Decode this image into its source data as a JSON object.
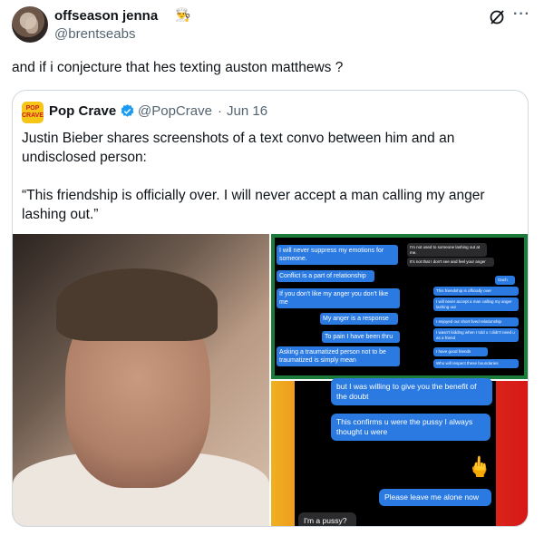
{
  "author": {
    "name": "offseason jenna",
    "name_emoji": "👨‍🍳",
    "handle": "@brentseabs"
  },
  "actions": {
    "more": "···"
  },
  "tweet": {
    "text": "and if i conjecture that hes texting auston matthews ?"
  },
  "quote": {
    "avatar_text": "POP CRAVE",
    "name": "Pop Crave",
    "handle": "@PopCrave",
    "separator": "·",
    "date": "Jun 16",
    "paragraph1": "Justin Bieber shares screenshots of a text convo between him and an undisclosed person:",
    "paragraph2": "“This friendship is officially over. I will never accept a man calling my anger lashing out.”"
  },
  "screenshot1": {
    "left": [
      "I will never suppress my emotions for someone.",
      "Conflict is a part of relationship",
      "If you don't like my anger you don't like me",
      "My anger is a response",
      "To pain I have been thru",
      "Asking a traumatized person not to be traumatized is simply mean"
    ],
    "right_gray": [
      "I'm not used to someone lashing out at me.",
      "It's not that I don't see and feel your anger"
    ],
    "right_blue": [
      "Ouch",
      "This friendship is officially over",
      "I will never accept a man calling my anger lashing out",
      "I enjoyed our short lived relationship",
      "I wasn't kidding when I told u I didn't need u as a friend",
      "I have good friends",
      "Who will respect these boundaries"
    ]
  },
  "screenshot2": {
    "msg1": "but I was willing to give you the benefit of the doubt",
    "msg2": "This confirms u were the pussy I always thought u were",
    "emoji": "🖕",
    "msg3": "Please leave me alone now",
    "msg4": "I'm a pussy?"
  },
  "colors": {
    "verified": "#1d9bf0",
    "imessage_blue": "#2a7ae2",
    "secondary_text": "#536471"
  }
}
